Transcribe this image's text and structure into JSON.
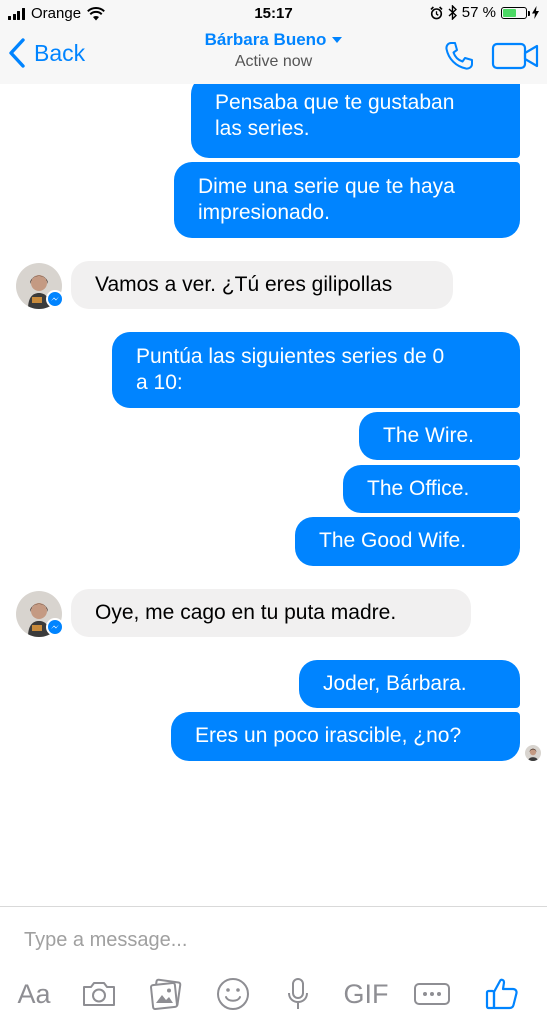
{
  "status_bar": {
    "carrier": "Orange",
    "time": "15:17",
    "battery": "57 %",
    "battery_level": 0.57
  },
  "header": {
    "back_label": "Back",
    "contact_name": "Bárbara Bueno",
    "status": "Active now"
  },
  "messages": [
    {
      "from": "me",
      "text": "Pensaba que te gustaban\nlas series."
    },
    {
      "from": "me",
      "text": "Dime una serie que te haya\nimpresionado."
    },
    {
      "from": "them",
      "text": "Vamos a ver. ¿Tú eres gilipollas"
    },
    {
      "from": "me",
      "text": "Puntúa las siguientes series de 0\na 10:"
    },
    {
      "from": "me",
      "text": "The Wire."
    },
    {
      "from": "me",
      "text": "The Office."
    },
    {
      "from": "me",
      "text": "The Good Wife."
    },
    {
      "from": "them",
      "text": "Oye, me cago en tu puta madre."
    },
    {
      "from": "me",
      "text": "Joder, Bárbara."
    },
    {
      "from": "me",
      "text": "Eres un poco irascible, ¿no?"
    }
  ],
  "composer": {
    "placeholder": "Type a message...",
    "aa_label": "Aa",
    "gif_label": "GIF"
  },
  "colors": {
    "accent": "#0084ff",
    "incoming_bubble": "#f1f0f0",
    "battery": "#4cd964",
    "icon_gray": "#8e8e93"
  },
  "icons": {
    "status": [
      "signal-icon",
      "wifi-icon",
      "alarm-icon",
      "bluetooth-icon",
      "battery-icon",
      "charging-icon"
    ],
    "header": [
      "chevron-left-icon",
      "chevron-down-icon",
      "phone-icon",
      "video-camera-icon"
    ],
    "toolbar": [
      "camera-icon",
      "gallery-icon",
      "emoji-icon",
      "microphone-icon",
      "more-icon",
      "thumbs-up-icon"
    ]
  }
}
